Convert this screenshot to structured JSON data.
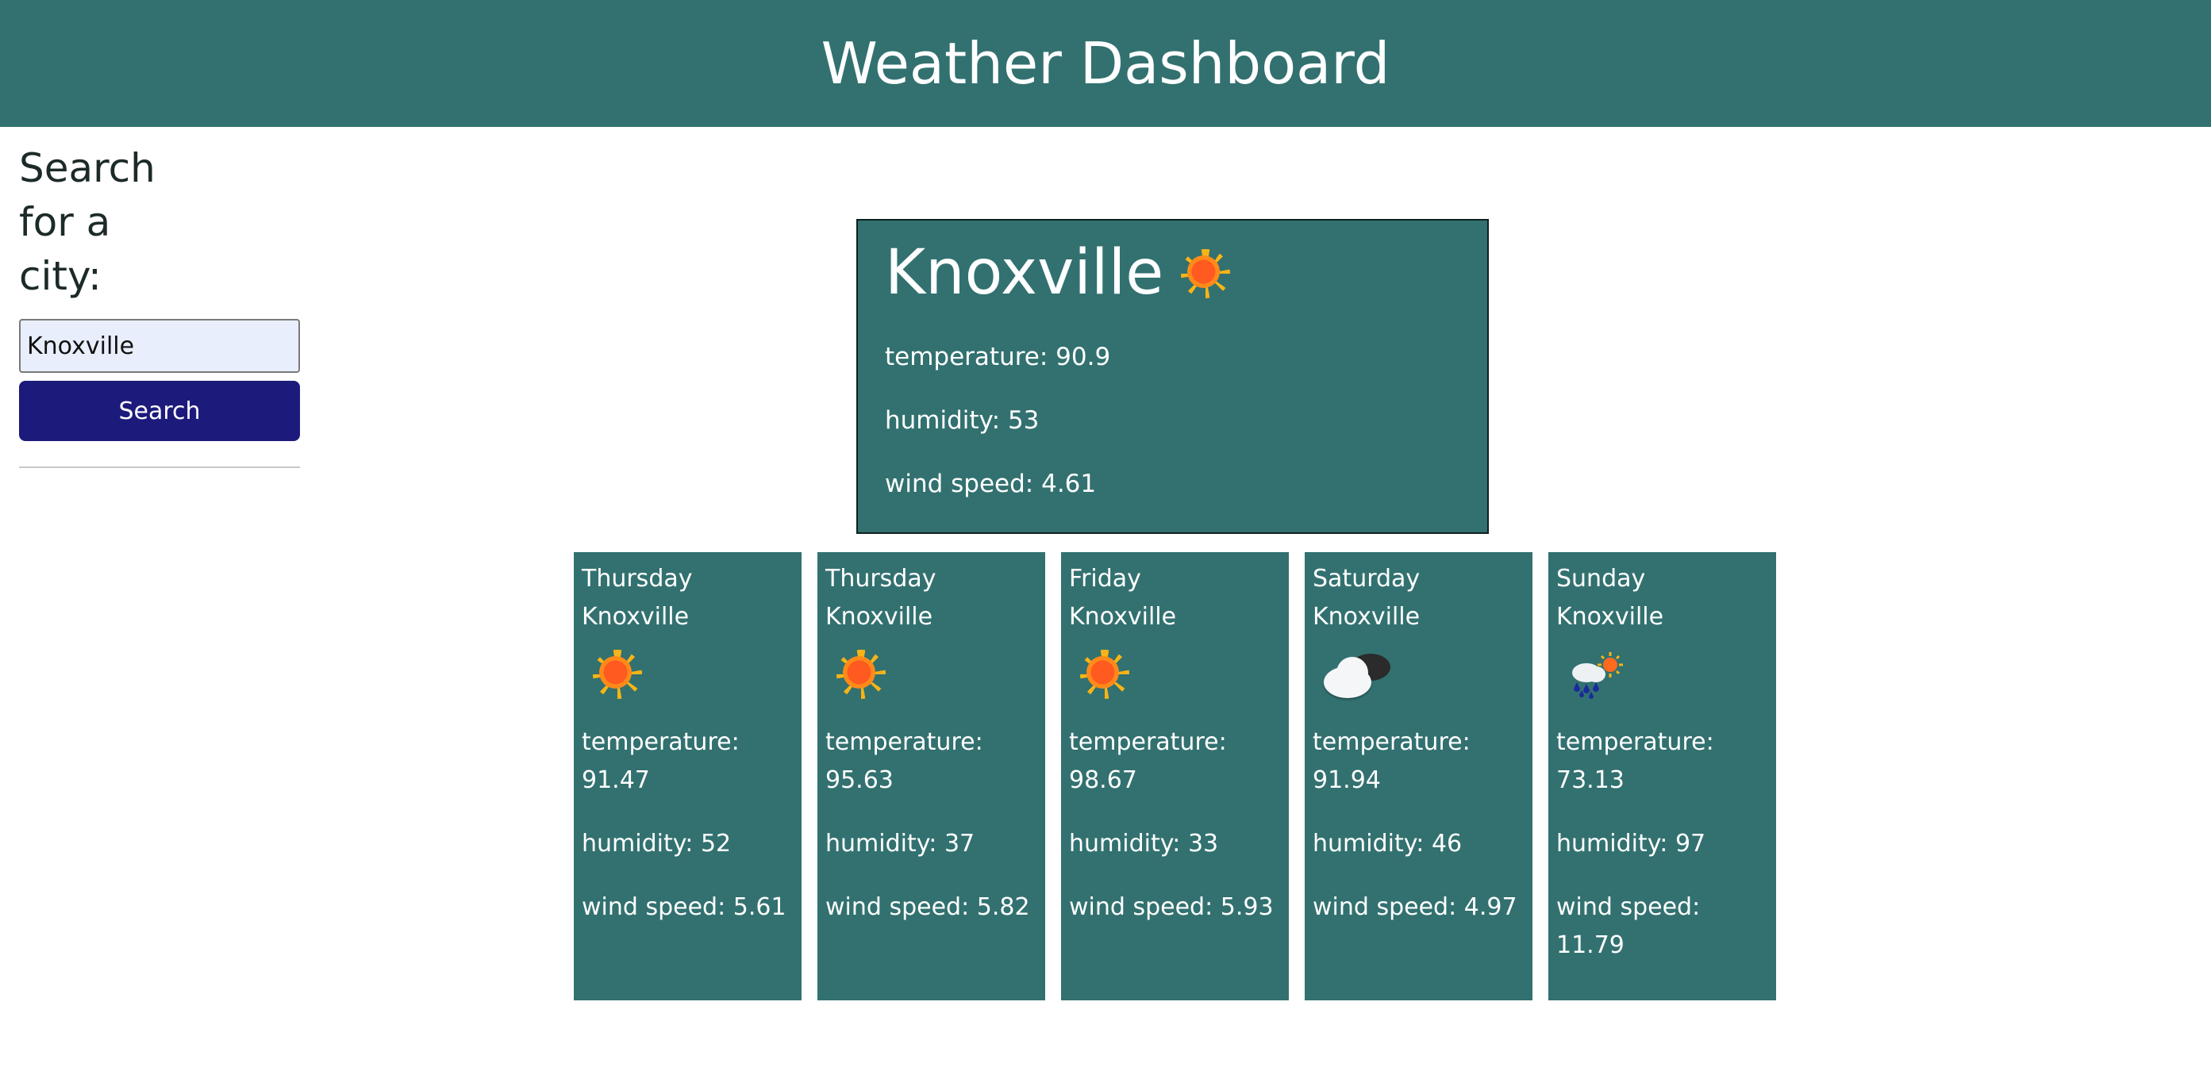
{
  "header": {
    "title": "Weather Dashboard"
  },
  "search": {
    "label": "Search for a city:",
    "value": "Knoxville",
    "button_label": "Search"
  },
  "current": {
    "city": "Knoxville",
    "icon": "sun-icon",
    "temperature": "temperature: 90.9",
    "humidity": "humidity: 53",
    "wind_speed": "wind speed: 4.61"
  },
  "forecast": [
    {
      "day": "Thursday",
      "city": "Knoxville",
      "icon": "sun-icon",
      "temperature_label": "temperature:",
      "temperature": "91.47",
      "humidity": "humidity: 52",
      "wind_speed": "wind speed: 5.61"
    },
    {
      "day": "Thursday",
      "city": "Knoxville",
      "icon": "sun-icon",
      "temperature_label": "temperature:",
      "temperature": "95.63",
      "humidity": "humidity: 37",
      "wind_speed": "wind speed: 5.82"
    },
    {
      "day": "Friday",
      "city": "Knoxville",
      "icon": "sun-icon",
      "temperature_label": "temperature:",
      "temperature": "98.67",
      "humidity": "humidity: 33",
      "wind_speed": "wind speed: 5.93"
    },
    {
      "day": "Saturday",
      "city": "Knoxville",
      "icon": "cloud-icon",
      "temperature_label": "temperature:",
      "temperature": "91.94",
      "humidity": "humidity: 46",
      "wind_speed": "wind speed: 4.97"
    },
    {
      "day": "Sunday",
      "city": "Knoxville",
      "icon": "rain-sun-icon",
      "temperature_label": "temperature:",
      "temperature": "73.13",
      "humidity": "humidity: 97",
      "wind_speed": "wind speed: 11.79"
    }
  ],
  "colors": {
    "teal": "#327170",
    "button": "#1c1b7c",
    "input_bg": "#e8eefb"
  }
}
